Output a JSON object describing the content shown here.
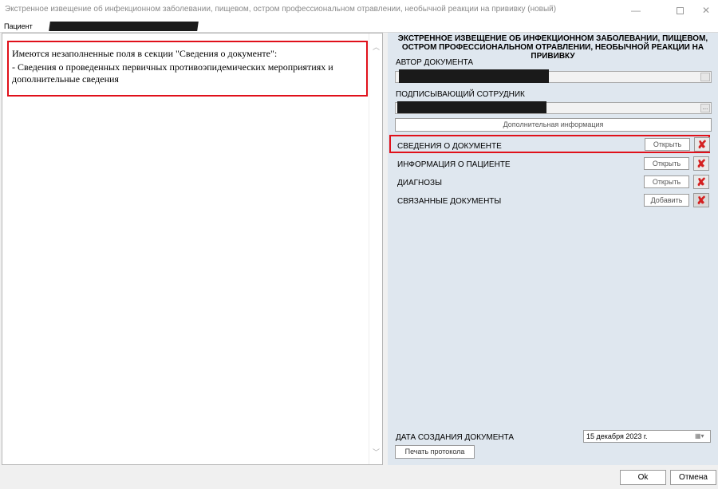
{
  "window": {
    "title": "Экстренное извещение об инфекционном заболевании, пищевом, остром профессиональном отравлении, необычной реакции на прививку  (новый)"
  },
  "patient_bar": {
    "label": "Пациент"
  },
  "left_panel": {
    "message_line1": "Имеются незаполненные поля в секции \"Сведения о документе\":",
    "message_line2": "- Сведения о проведенных первичных противоэпидемических мероприятиях и",
    "message_line3": "дополнительные сведения"
  },
  "right_panel": {
    "title_line1": "ЭКСТРЕННОЕ ИЗВЕЩЕНИЕ ОБ ИНФЕКЦИОННОМ ЗАБОЛЕВАНИИ, ПИЩЕВОМ,",
    "title_line2": "ОСТРОМ ПРОФЕССИОНАЛЬНОМ ОТРАВЛЕНИИ, НЕОБЫЧНОЙ РЕАКЦИИ НА",
    "title_line3": "ПРИВИВКУ",
    "author_label": "АВТОР ДОКУМЕНТА",
    "signer_label": "ПОДПИСЫВАЮЩИЙ СОТРУДНИК",
    "signer_button": "...",
    "extra_info_button": "Дополнительная информация",
    "sections": [
      {
        "label": "СВЕДЕНИЯ О ДОКУМЕНТЕ",
        "button": "Открыть"
      },
      {
        "label": "ИНФОРМАЦИЯ О ПАЦИЕНТЕ",
        "button": "Открыть"
      },
      {
        "label": "ДИАГНОЗЫ",
        "button": "Открыть"
      },
      {
        "label": "СВЯЗАННЫЕ ДОКУМЕНТЫ",
        "button": "Добавить"
      }
    ],
    "creation_date_label": "ДАТА СОЗДАНИЯ ДОКУМЕНТА",
    "creation_date_value": "15 декабря  2023 г.",
    "print_button": "Печать протокола"
  },
  "footer": {
    "ok": "Ok",
    "cancel": "Отмена"
  },
  "colors": {
    "highlight": "#e0101a",
    "right_panel_bg": "#dfe7ef",
    "delete_icon": "#d42020"
  }
}
